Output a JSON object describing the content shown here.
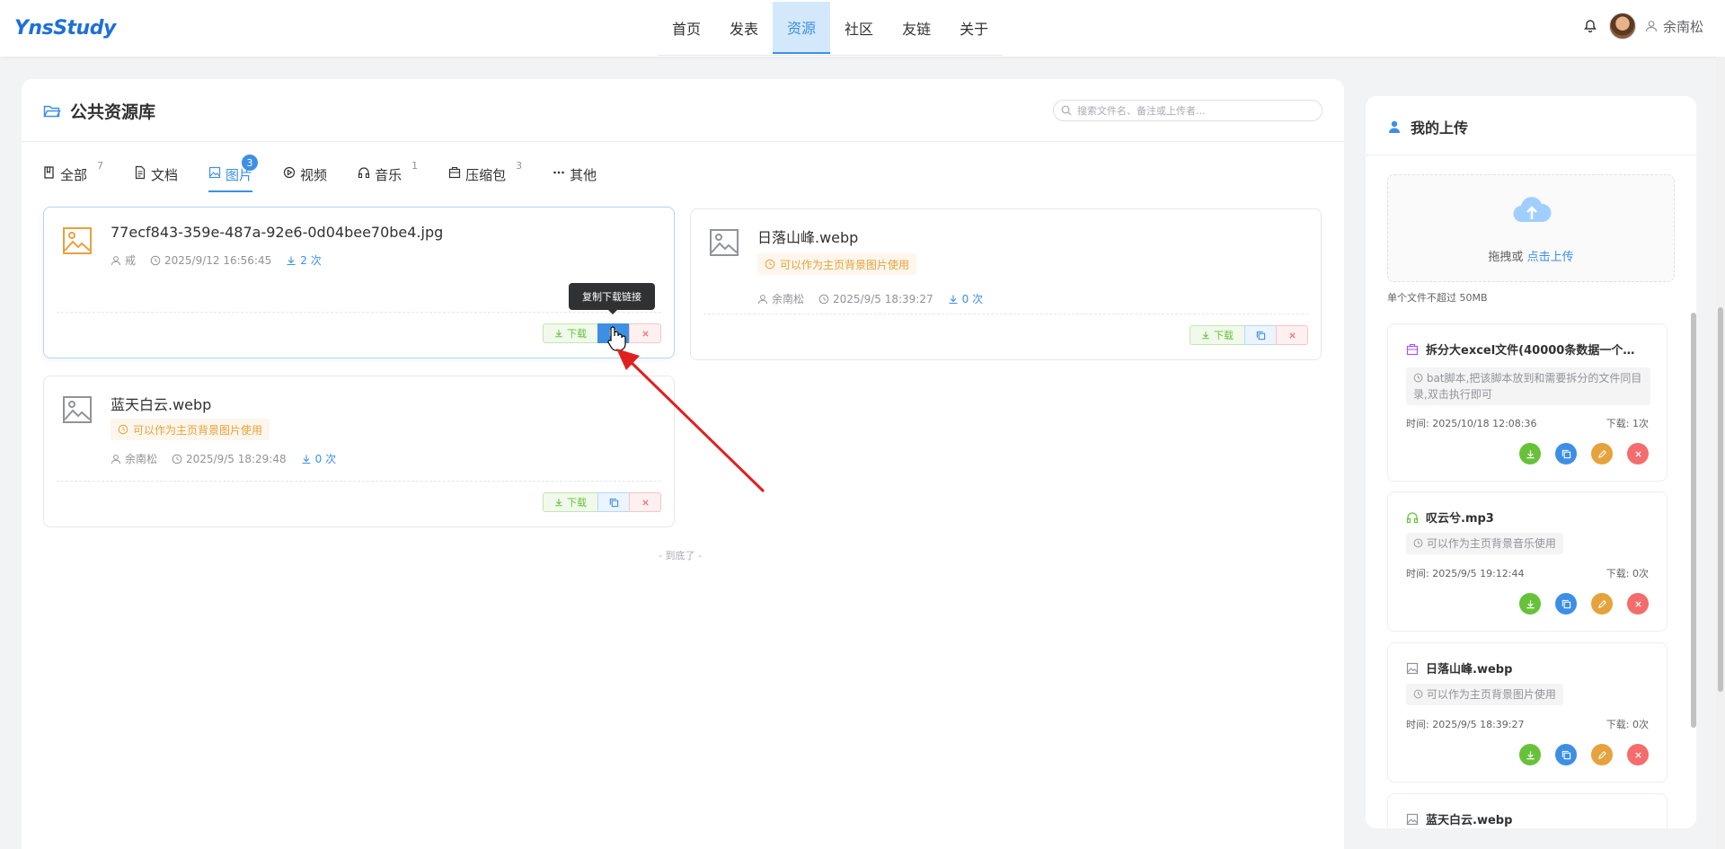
{
  "header": {
    "logo": "YnsStudy",
    "nav": [
      "首页",
      "发表",
      "资源",
      "社区",
      "友链",
      "关于"
    ],
    "active_nav": "资源",
    "user_name": "余南松"
  },
  "library": {
    "title": "公共资源库",
    "search_placeholder": "搜索文件名、备注或上传者...",
    "tabs": [
      {
        "label": "全部",
        "count": "7"
      },
      {
        "label": "文档",
        "count": ""
      },
      {
        "label": "图片",
        "count": "3"
      },
      {
        "label": "视频",
        "count": ""
      },
      {
        "label": "音乐",
        "count": "1"
      },
      {
        "label": "压缩包",
        "count": "3"
      },
      {
        "label": "其他",
        "count": ""
      }
    ],
    "active_tab": "图片",
    "files": [
      {
        "name": "77ecf843-359e-487a-92e6-0d04bee70be4.jpg",
        "note": "",
        "uploader": "戒",
        "time": "2025/9/12 16:56:45",
        "downloads": "2 次"
      },
      {
        "name": "日落山峰.webp",
        "note": "可以作为主页背景图片使用",
        "uploader": "余南松",
        "time": "2025/9/5 18:39:27",
        "downloads": "0 次"
      },
      {
        "name": "蓝天白云.webp",
        "note": "可以作为主页背景图片使用",
        "uploader": "余南松",
        "time": "2025/9/5 18:29:48",
        "downloads": "0 次"
      }
    ],
    "download_label": "下载",
    "tooltip": "复制下载链接",
    "end_text": "- 到底了 -"
  },
  "my_uploads": {
    "title": "我的上传",
    "upload_text": "拖拽或",
    "upload_link": "点击上传",
    "limit": "单个文件不超过 50MB",
    "items": [
      {
        "name": "拆分大excel文件(40000条数据一个…",
        "note": "bat脚本,把该脚本放到和需要拆分的文件同目录,双击执行即可",
        "time": "时间: 2025/10/18 12:08:36",
        "downloads": "下载: 1次",
        "icon": "package-icon"
      },
      {
        "name": "叹云兮.mp3",
        "note": "可以作为主页背景音乐使用",
        "time": "时间: 2025/9/5 19:12:44",
        "downloads": "下载: 0次",
        "icon": "headphones-icon"
      },
      {
        "name": "日落山峰.webp",
        "note": "可以作为主页背景图片使用",
        "time": "时间: 2025/9/5 18:39:27",
        "downloads": "下载: 0次",
        "icon": "image-icon"
      },
      {
        "name": "蓝天白云.webp",
        "note": "",
        "time": "",
        "downloads": "",
        "icon": "image-icon"
      }
    ]
  },
  "colors": {
    "primary": "#3d8fe6",
    "success": "#67c23a",
    "warning": "#e6a23c",
    "danger": "#f56c6c"
  }
}
